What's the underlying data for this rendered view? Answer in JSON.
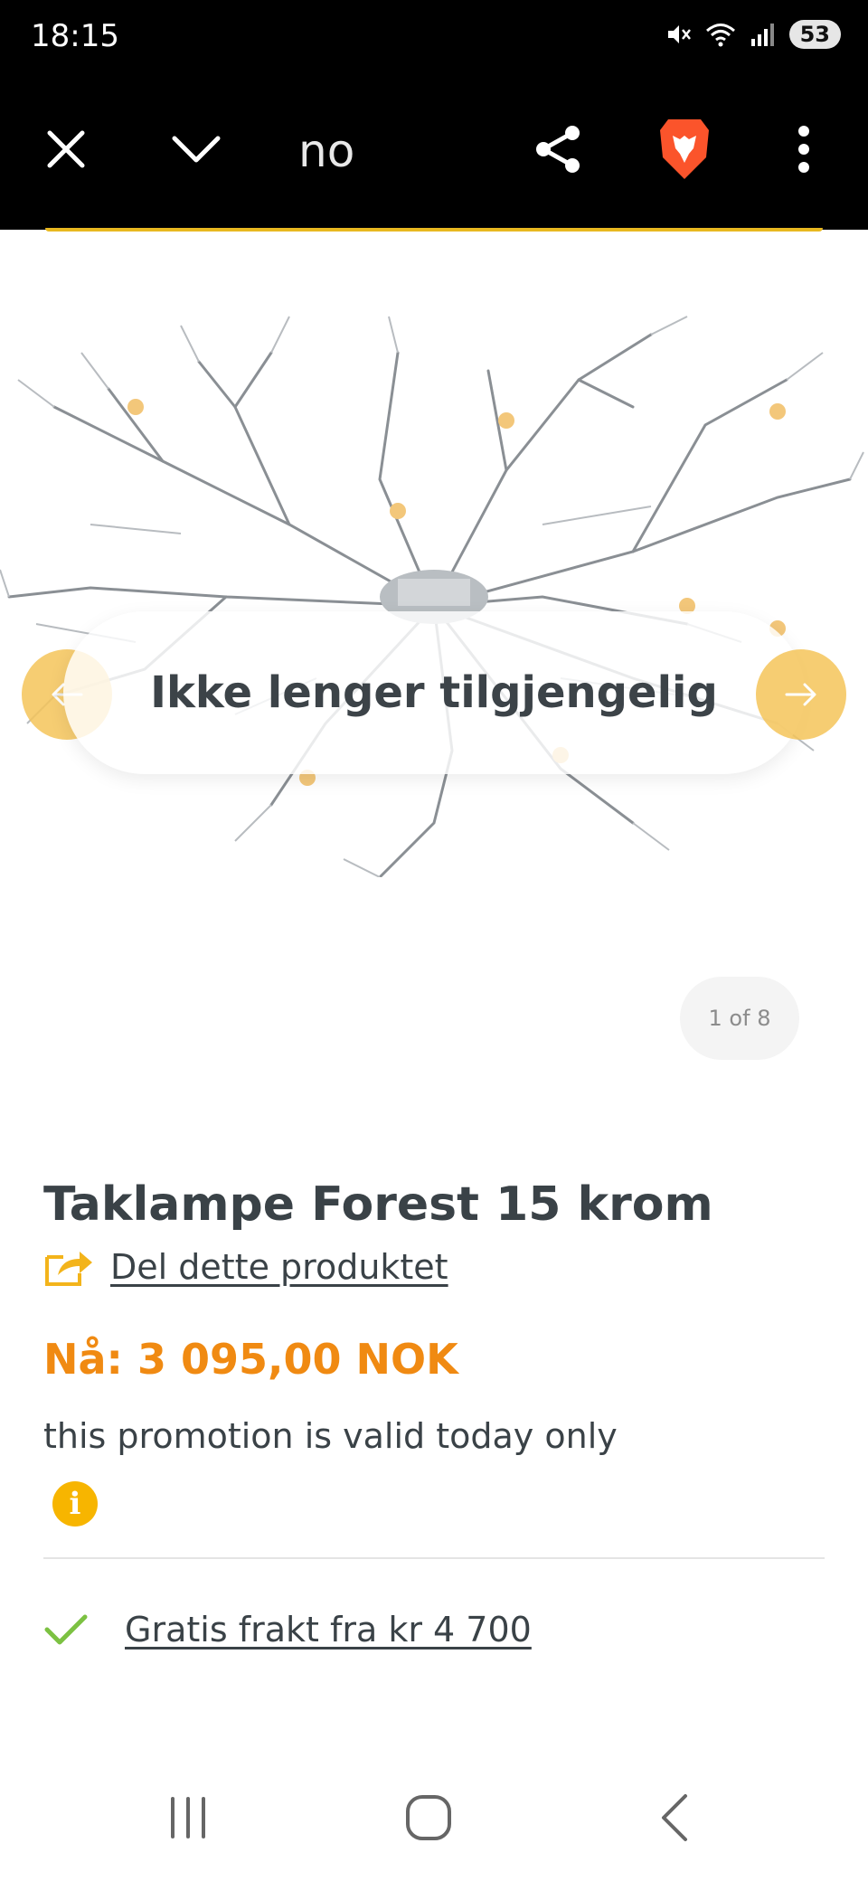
{
  "status_bar": {
    "time": "18:15",
    "battery": "53"
  },
  "browser": {
    "url_text": "no",
    "icons": [
      "close-icon",
      "chevron-down-icon",
      "share-icon",
      "brave-lion-icon",
      "more-vert-icon"
    ],
    "accent": "#e8b820"
  },
  "gallery": {
    "unavailable_label": "Ikke lenger tilgjengelig",
    "counter": "1 of 8",
    "arrow_color": "#f5c55a"
  },
  "product": {
    "title": "Taklampe Forest 15 krom",
    "share_label": "Del dette produktet",
    "price": "Nå: 3 095,00 NOK",
    "promotion": "this promotion is valid today only",
    "info_icon_text": "i",
    "shipping": "Gratis frakt fra kr 4 700",
    "price_color": "#f08a12",
    "check_color": "#7cc142"
  }
}
